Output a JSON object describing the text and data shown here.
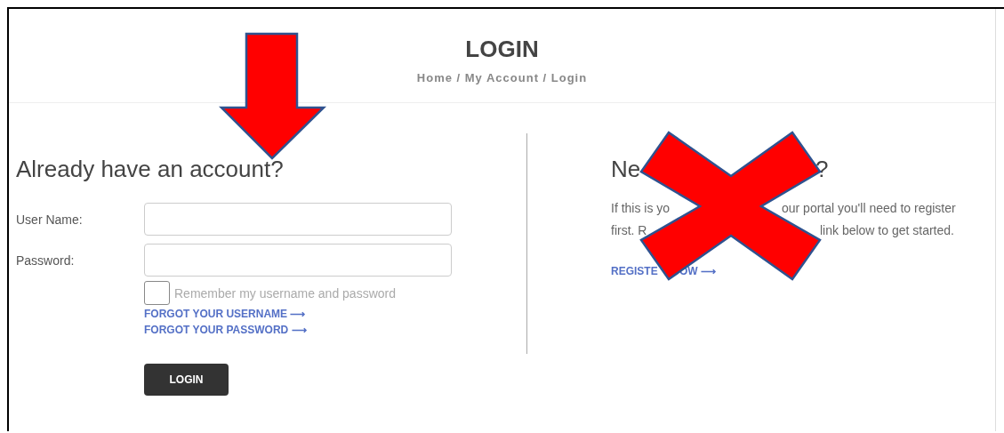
{
  "header": {
    "title": "LOGIN",
    "breadcrumb": "Home / My Account / Login"
  },
  "login": {
    "heading": "Already have an account?",
    "fields": [
      {
        "label": "User Name:"
      },
      {
        "label": "Password:"
      }
    ],
    "remember": {
      "label": "Remember my username and password",
      "checked": false
    },
    "links": [
      "FORGOT YOUR USERNAME ⟶",
      "FORGOT YOUR PASSWORD ⟶"
    ],
    "button": "LOGIN"
  },
  "register": {
    "heading_fragments": [
      "Ne",
      "?"
    ],
    "text_lines": [
      [
        "If this is yo",
        "our portal you'll need to register"
      ],
      [
        "first. R",
        "link below to get started."
      ]
    ],
    "link_fragments": [
      "REGISTE",
      "OW ⟶"
    ]
  },
  "annotations": [
    {
      "kind": "arrow"
    },
    {
      "kind": "cross"
    }
  ]
}
